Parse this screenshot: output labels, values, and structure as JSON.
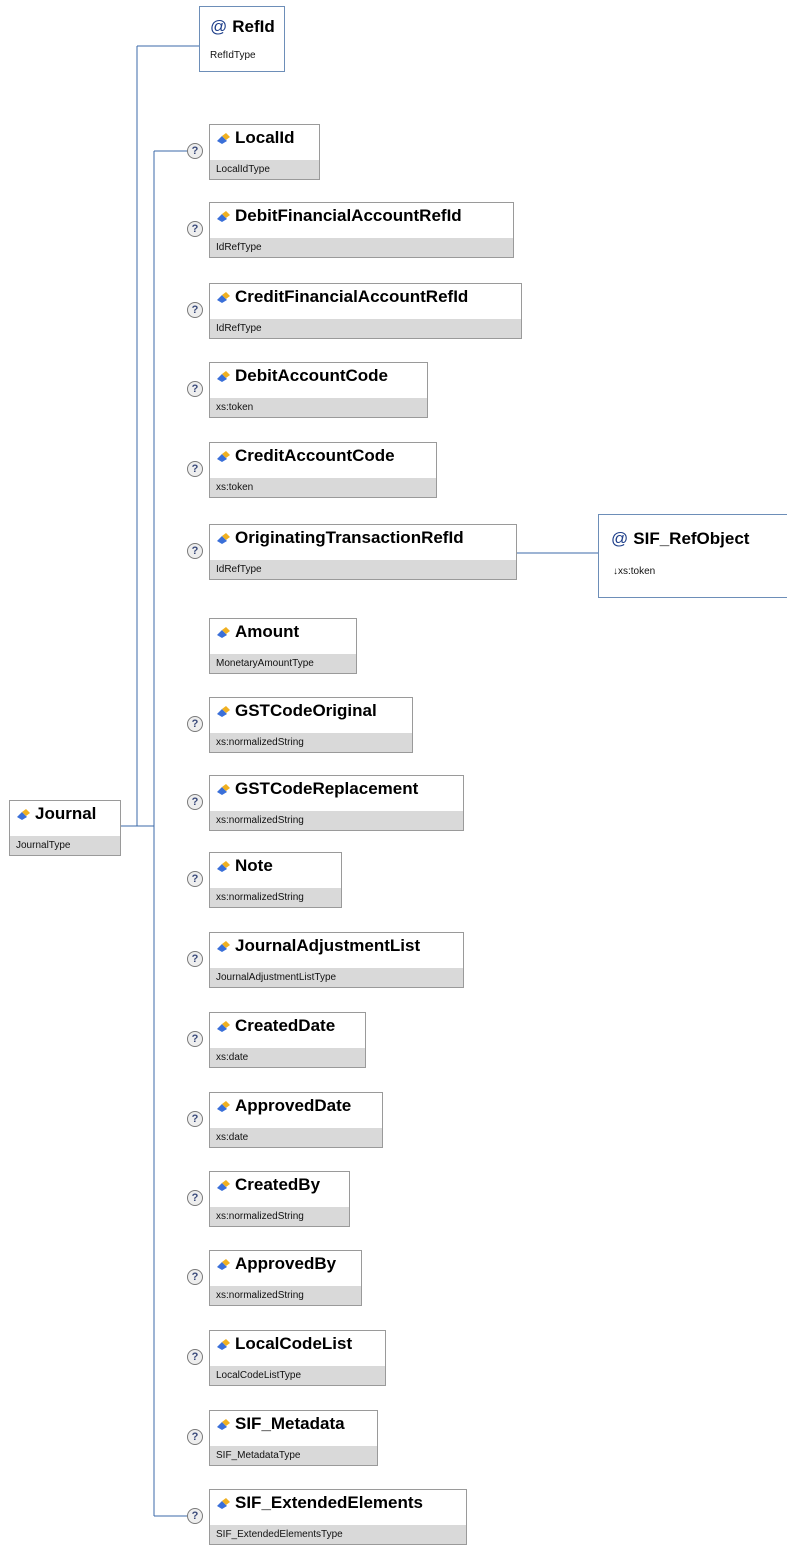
{
  "root": {
    "name": "Journal",
    "type": "JournalType",
    "icon": "element-icon"
  },
  "attributes": [
    {
      "id": "refid",
      "name": "RefId",
      "type": "RefIdType",
      "icon": "attribute-icon"
    }
  ],
  "children": [
    {
      "id": "localid",
      "name": "LocalId",
      "type": "LocalIdType",
      "optional": true
    },
    {
      "id": "debitfinancialaccountrefid",
      "name": "DebitFinancialAccountRefId",
      "type": "IdRefType",
      "optional": true
    },
    {
      "id": "creditfinancialaccountrefid",
      "name": "CreditFinancialAccountRefId",
      "type": "IdRefType",
      "optional": true
    },
    {
      "id": "debitaccountcode",
      "name": "DebitAccountCode",
      "type": "xs:token",
      "optional": true
    },
    {
      "id": "creditaccountcode",
      "name": "CreditAccountCode",
      "type": "xs:token",
      "optional": true
    },
    {
      "id": "originatingtransactionrefid",
      "name": "OriginatingTransactionRefId",
      "type": "IdRefType",
      "optional": true
    },
    {
      "id": "amount",
      "name": "Amount",
      "type": "MonetaryAmountType",
      "optional": false
    },
    {
      "id": "gstcodeoriginal",
      "name": "GSTCodeOriginal",
      "type": "xs:normalizedString",
      "optional": true
    },
    {
      "id": "gstcodereplacement",
      "name": "GSTCodeReplacement",
      "type": "xs:normalizedString",
      "optional": true
    },
    {
      "id": "note",
      "name": "Note",
      "type": "xs:normalizedString",
      "optional": true
    },
    {
      "id": "journaladjustmentlist",
      "name": "JournalAdjustmentList",
      "type": "JournalAdjustmentListType",
      "optional": true
    },
    {
      "id": "createddate",
      "name": "CreatedDate",
      "type": "xs:date",
      "optional": true
    },
    {
      "id": "approveddate",
      "name": "ApprovedDate",
      "type": "xs:date",
      "optional": true
    },
    {
      "id": "createdby",
      "name": "CreatedBy",
      "type": "xs:normalizedString",
      "optional": true
    },
    {
      "id": "approvedby",
      "name": "ApprovedBy",
      "type": "xs:normalizedString",
      "optional": true
    },
    {
      "id": "localcodelist",
      "name": "LocalCodeList",
      "type": "LocalCodeListType",
      "optional": true
    },
    {
      "id": "sif-metadata",
      "name": "SIF_Metadata",
      "type": "SIF_MetadataType",
      "optional": true
    },
    {
      "id": "sif-extendedelements",
      "name": "SIF_ExtendedElements",
      "type": "SIF_ExtendedElementsType",
      "optional": true
    }
  ],
  "nested_attribute": {
    "parent": "OriginatingTransactionRefId",
    "name": "SIF_RefObject",
    "type": "↓xs:token",
    "icon": "attribute-icon"
  },
  "optional_marker": "?",
  "attribute_marker": "@",
  "colors": {
    "connector": "#3b6aa8",
    "element_icon": "#3a6fd8",
    "element_icon_accent": "#f0b020",
    "type_bar": "#d9d9d9"
  }
}
